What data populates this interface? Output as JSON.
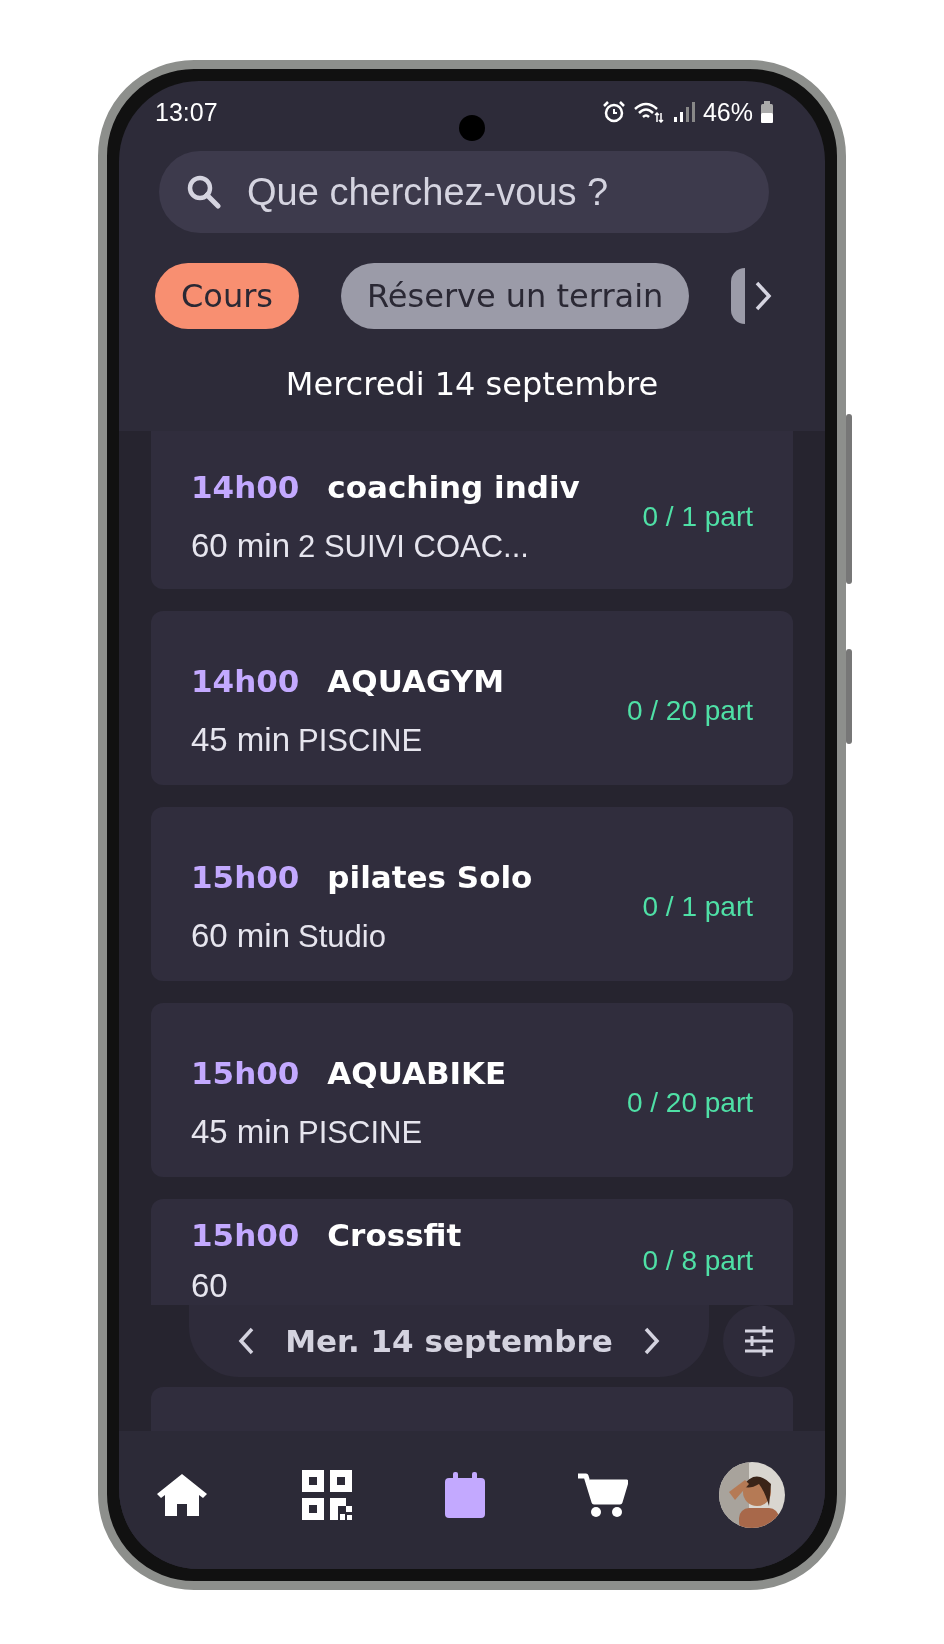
{
  "status_bar": {
    "time": "13:07",
    "battery": "46%"
  },
  "search": {
    "placeholder": "Que cherchez-vous ?"
  },
  "chips": [
    {
      "label": "Cours",
      "selected": true
    },
    {
      "label": "Réserve un terrain",
      "selected": false
    }
  ],
  "date_heading": "Mercredi 14 septembre",
  "sessions": [
    {
      "time": "14h00",
      "title": "coaching indiv",
      "duration": "60 min",
      "location": "2 SUIVI COAC...",
      "participants": "0 / 1 part"
    },
    {
      "time": "14h00",
      "title": "AQUAGYM",
      "duration": "45 min",
      "location": "PISCINE",
      "participants": "0 / 20 part"
    },
    {
      "time": "15h00",
      "title": "pilates Solo",
      "duration": "60 min",
      "location": "Studio",
      "participants": "0 / 1 part"
    },
    {
      "time": "15h00",
      "title": "AQUABIKE",
      "duration": "45 min",
      "location": "PISCINE",
      "participants": "0 / 20 part"
    },
    {
      "time": "15h00",
      "title": "Crossfit",
      "duration": "60",
      "participants": "0 / 8 part"
    }
  ],
  "date_bar": {
    "label": "Mer. 14 septembre"
  },
  "nav": [
    {
      "kind": "home",
      "selected": false
    },
    {
      "kind": "qr",
      "selected": false
    },
    {
      "kind": "calendar",
      "selected": true
    },
    {
      "kind": "cart",
      "selected": false
    },
    {
      "kind": "avatar",
      "selected": false
    }
  ]
}
